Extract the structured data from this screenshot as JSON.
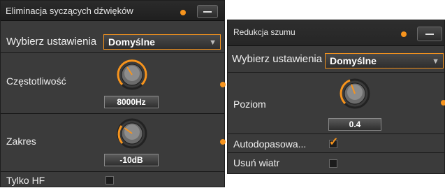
{
  "left": {
    "title": "Eliminacja syczących dźwięków",
    "preset_label": "Wybierz ustawienia",
    "preset_value": "Domyślne",
    "frequency_label": "Częstotliwość",
    "frequency_value": "8000Hz",
    "range_label": "Zakres",
    "range_value": "-10dB",
    "hf_only_label": "Tylko HF"
  },
  "right": {
    "title": "Redukcja szumu",
    "preset_label": "Wybierz ustawienia",
    "preset_value": "Domyślne",
    "level_label": "Poziom",
    "level_value": "0.4",
    "autofit_label": "Autodopasowa...",
    "remove_wind_label": "Usuń wiatr"
  },
  "colors": {
    "accent": "#f7941d",
    "panel": "#3b3b3b"
  },
  "icons": {
    "minimize": "minimize-icon",
    "dropdown": "dropdown-arrow-icon",
    "check": "checkmark-icon"
  }
}
